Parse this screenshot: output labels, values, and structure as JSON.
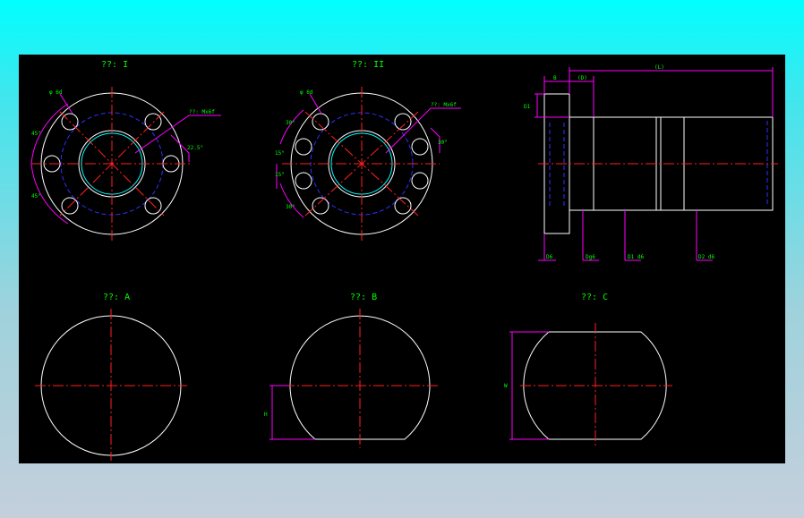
{
  "views": {
    "top_left_title": "??: I",
    "top_mid_title": "??: II",
    "bottom_left_title": "??: A",
    "bottom_mid_title": "??: B",
    "bottom_right_title": "??: C"
  },
  "callouts": {
    "tl_hole": "φ 6d",
    "tl_note": "??: Mx6f",
    "tl_angle": "22.5°",
    "tl_arc_top": "45°",
    "tl_arc_bot": "45°",
    "tm_hole": "φ 6d",
    "tm_note": "??: Mx6f",
    "tm_a1": "30°",
    "tm_a2": "15°",
    "tm_a3": "15°",
    "tm_a4": "30°",
    "tm_a5": "30°"
  },
  "side_view": {
    "top_dim_1": "B",
    "top_dim_2": "(D)",
    "top_dim_3": "(L)",
    "left_dim": "D1",
    "bottom_dims": [
      "D6",
      "Dg6",
      "D1 d6",
      "D2 d6"
    ]
  },
  "bottom_dims": {
    "b_height": "H",
    "c_width": "W"
  },
  "colors": {
    "outline": "#ffffff",
    "hidden": "#3030ff",
    "center": "#ff2020",
    "dimension": "#ff00ff",
    "text": "#00ff00"
  }
}
